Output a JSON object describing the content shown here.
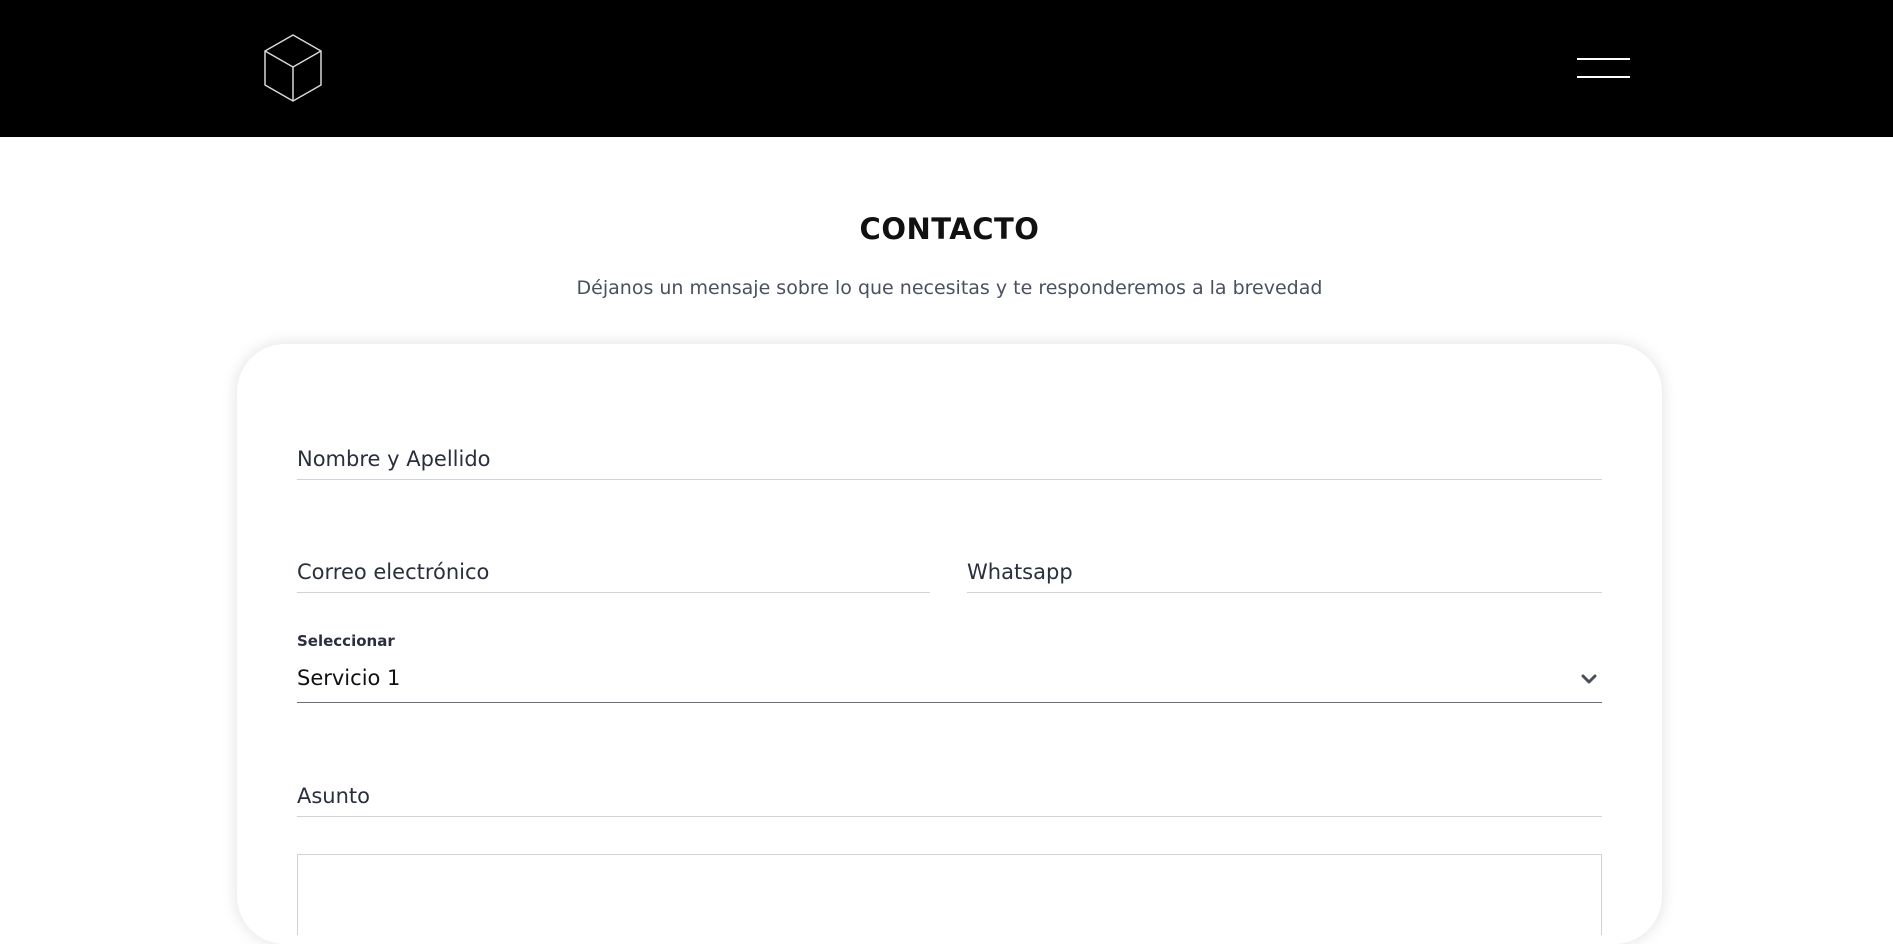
{
  "header": {
    "logo_icon": "cube-outline-icon",
    "menu_icon": "hamburger-menu-icon"
  },
  "contact": {
    "title": "CONTACTO",
    "subtitle": "Déjanos un mensaje sobre lo que necesitas y te responderemos a la brevedad"
  },
  "form": {
    "name_placeholder": "Nombre y Apellido",
    "email_placeholder": "Correo electrónico",
    "whatsapp_placeholder": "Whatsapp",
    "select_label": "Seleccionar",
    "select_value": "Servicio 1",
    "subject_placeholder": "Asunto"
  },
  "colors": {
    "header_bg": "#000000",
    "text_dark": "#2a2f3d",
    "subtitle": "#4a5060"
  }
}
